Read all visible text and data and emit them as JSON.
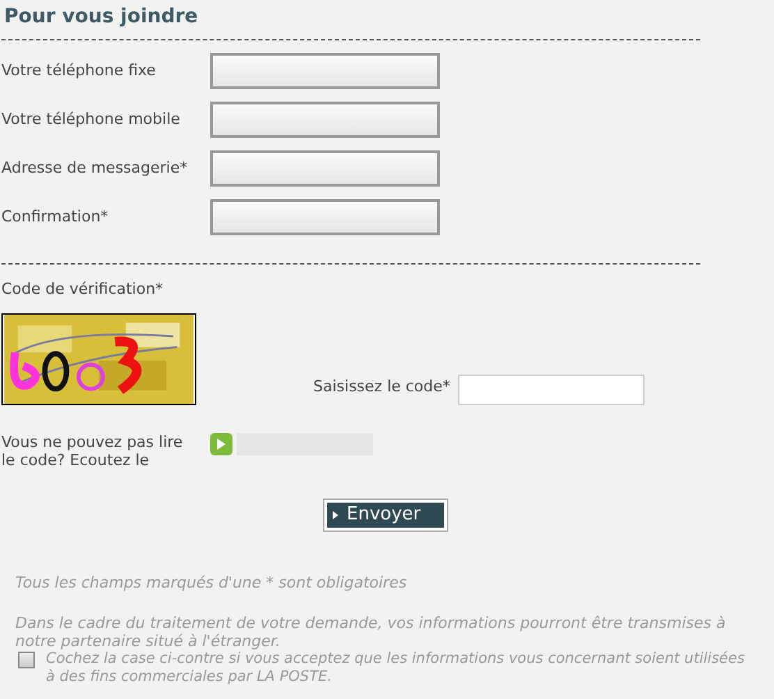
{
  "title": "Pour vous joindre",
  "fields": [
    {
      "label": "Votre téléphone fixe"
    },
    {
      "label": "Votre téléphone mobile"
    },
    {
      "label": "Adresse de messagerie*"
    },
    {
      "label": "Confirmation*"
    }
  ],
  "verification": {
    "label": "Code de vérification*",
    "code_label": "Saisissez le code*",
    "audio_text": "Vous ne pouvez pas lire le code? Ecoutez le"
  },
  "submit": "Envoyer",
  "required_note": "Tous les champs marqués d'une * sont obligatoires",
  "transfer_note": "Dans le cadre du traitement de votre demande, vos informations pourront être transmises à notre partenaire situé à l'étranger.",
  "consent": {
    "checked": false,
    "text": "Cochez la case ci-contre si vous acceptez que les informations vous concernant soient utilisées à des fins commerciales par LA POSTE."
  }
}
